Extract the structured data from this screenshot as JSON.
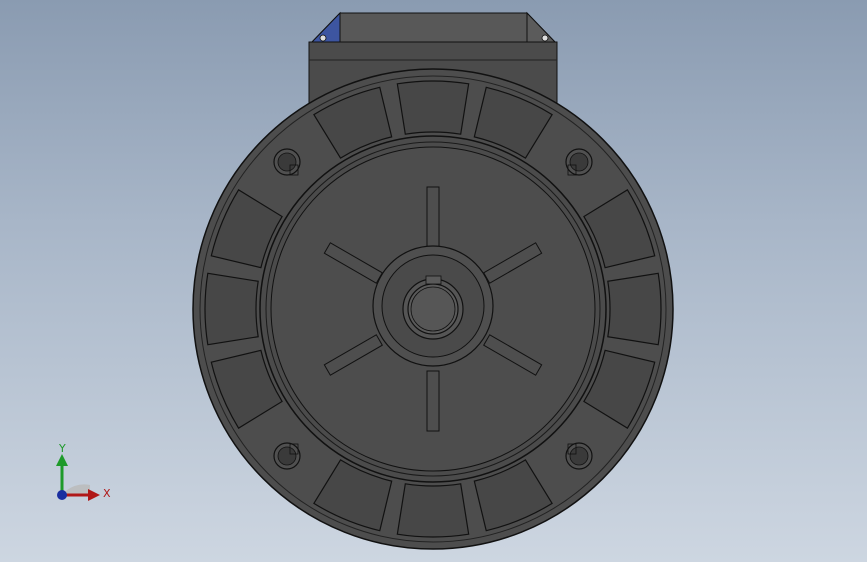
{
  "viewport": {
    "background_top": "#8a9bb1",
    "background_bottom": "#cdd6e1",
    "model_color": "#4a4a4a",
    "edge_color": "#111111"
  },
  "triad": {
    "x_label": "X",
    "y_label": "Y",
    "x_color": "#b01818",
    "y_color": "#1e9a2a",
    "z_color": "#1a2ea0"
  }
}
